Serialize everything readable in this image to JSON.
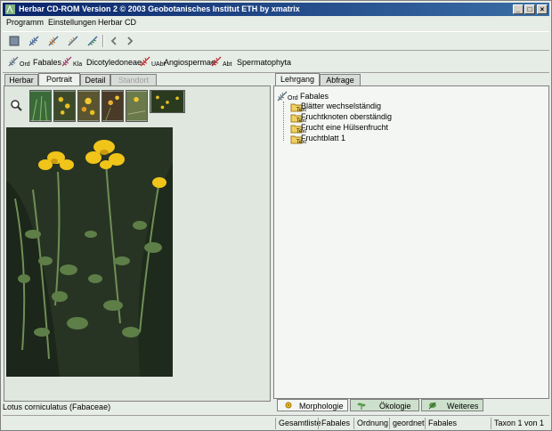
{
  "window": {
    "title": "Herbar CD-ROM Version 2 © 2003 Geobotanisches Institut ETH  by  xmatrix"
  },
  "menu": {
    "items": [
      "Programm",
      "Einstellungen",
      "Herbar CD"
    ]
  },
  "toolbar": {
    "icons": [
      "book-icon",
      "fern-icon-1",
      "fern-icon-2",
      "fern-icon-3",
      "fern-icon-4",
      "back-arrow-icon",
      "forward-arrow-icon"
    ]
  },
  "taxonomy": [
    {
      "rank": "Ord",
      "name": "Fabales"
    },
    {
      "rank": "Kla",
      "name": "Dicotyledoneae"
    },
    {
      "rank": "UAbt",
      "name": "Angiospermae"
    },
    {
      "rank": "Abt",
      "name": "Spermatophyta"
    }
  ],
  "left_tabs": [
    "Herbar",
    "Portrait",
    "Detail",
    "Standort"
  ],
  "caption": "Lotus corniculatus (Fabaceae)",
  "right_tabs": [
    "Lehrgang",
    "Abfrage"
  ],
  "tree": {
    "root_rank": "Ord",
    "root_name": "Fabales",
    "child_tag": "Text",
    "children": [
      "Blätter wechselständig",
      "Fruchtknoten oberständig",
      "Frucht eine Hülsenfrucht",
      "Fruchtblatt 1"
    ]
  },
  "bottom_tabs": [
    "Morphologie",
    "Ökologie",
    "Weiteres"
  ],
  "status": {
    "list": "Gesamtliste",
    "order_value": "Fabales",
    "sort_key": "Ordnung",
    "sort_mode": "geordnet",
    "group": "Fabales",
    "position": "Taxon 1 von 1"
  },
  "colors": {
    "title_start": "#0a246a",
    "title_end": "#3a6ea5",
    "panel_bg": "#dfe7df",
    "flower_yellow": "#f0c419"
  }
}
